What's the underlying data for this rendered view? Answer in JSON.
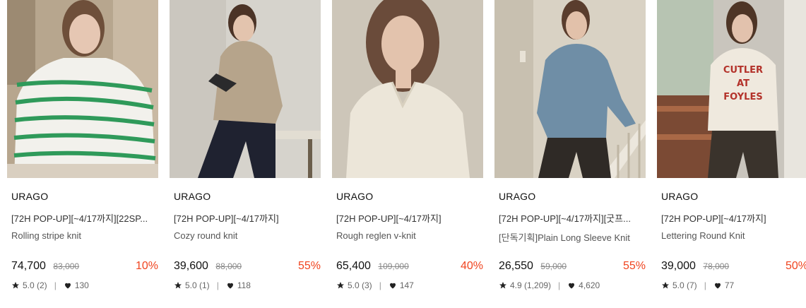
{
  "products": [
    {
      "brand": "URAGO",
      "tag": "[72H POP-UP][~4/17까지][22SP...",
      "name": "Rolling stripe knit",
      "price": "74,700",
      "original_price": "83,000",
      "discount": "10%",
      "rating": "5.0 (2)",
      "likes": "130"
    },
    {
      "brand": "URAGO",
      "tag": "[72H POP-UP][~4/17까지]",
      "name": "Cozy round knit",
      "price": "39,600",
      "original_price": "88,000",
      "discount": "55%",
      "rating": "5.0 (1)",
      "likes": "118"
    },
    {
      "brand": "URAGO",
      "tag": "[72H POP-UP][~4/17까지]",
      "name": "Rough reglen v-knit",
      "price": "65,400",
      "original_price": "109,000",
      "discount": "40%",
      "rating": "5.0 (3)",
      "likes": "147"
    },
    {
      "brand": "URAGO",
      "tag": "[72H POP-UP][~4/17까지][굿프...",
      "name": "[단독기획]Plain Long Sleeve Knit",
      "price": "26,550",
      "original_price": "59,000",
      "discount": "55%",
      "rating": "4.9 (1,209)",
      "likes": "4,620"
    },
    {
      "brand": "URAGO",
      "tag": "[72H POP-UP][~4/17까지]",
      "name": "Lettering Round Knit",
      "price": "39,000",
      "original_price": "78,000",
      "discount": "50%",
      "rating": "5.0 (7)",
      "likes": "77"
    }
  ],
  "colors": {
    "discount": "#f0441f",
    "text_primary": "#111111",
    "text_secondary": "#555555",
    "strike": "#888888"
  },
  "icons": {
    "rating": "star-icon",
    "likes": "heart-icon"
  }
}
